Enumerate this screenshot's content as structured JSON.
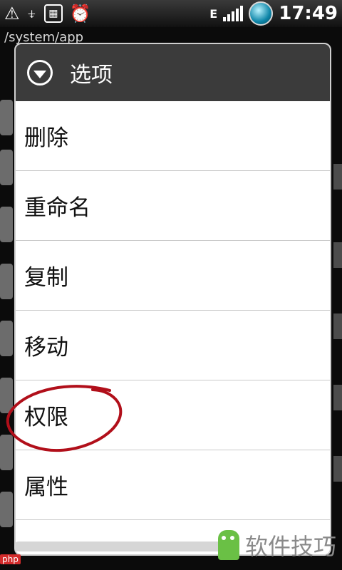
{
  "status_bar": {
    "time": "17:49",
    "network": "E",
    "icons": [
      "alert-triangle-icon",
      "usb-icon",
      "sd-card-icon",
      "alarm-clock-icon",
      "signal-bars-icon",
      "globe-icon"
    ]
  },
  "background": {
    "path": "/system/app"
  },
  "dialog": {
    "title": "选项",
    "items": [
      "删除",
      "重命名",
      "复制",
      "移动",
      "权限",
      "属性"
    ]
  },
  "watermark": {
    "text": "软件技巧",
    "corner_tag": "php"
  },
  "colors": {
    "header_bg": "#3b3b3b",
    "dialog_bg": "#ffffff",
    "annotation": "#b10f1a"
  }
}
